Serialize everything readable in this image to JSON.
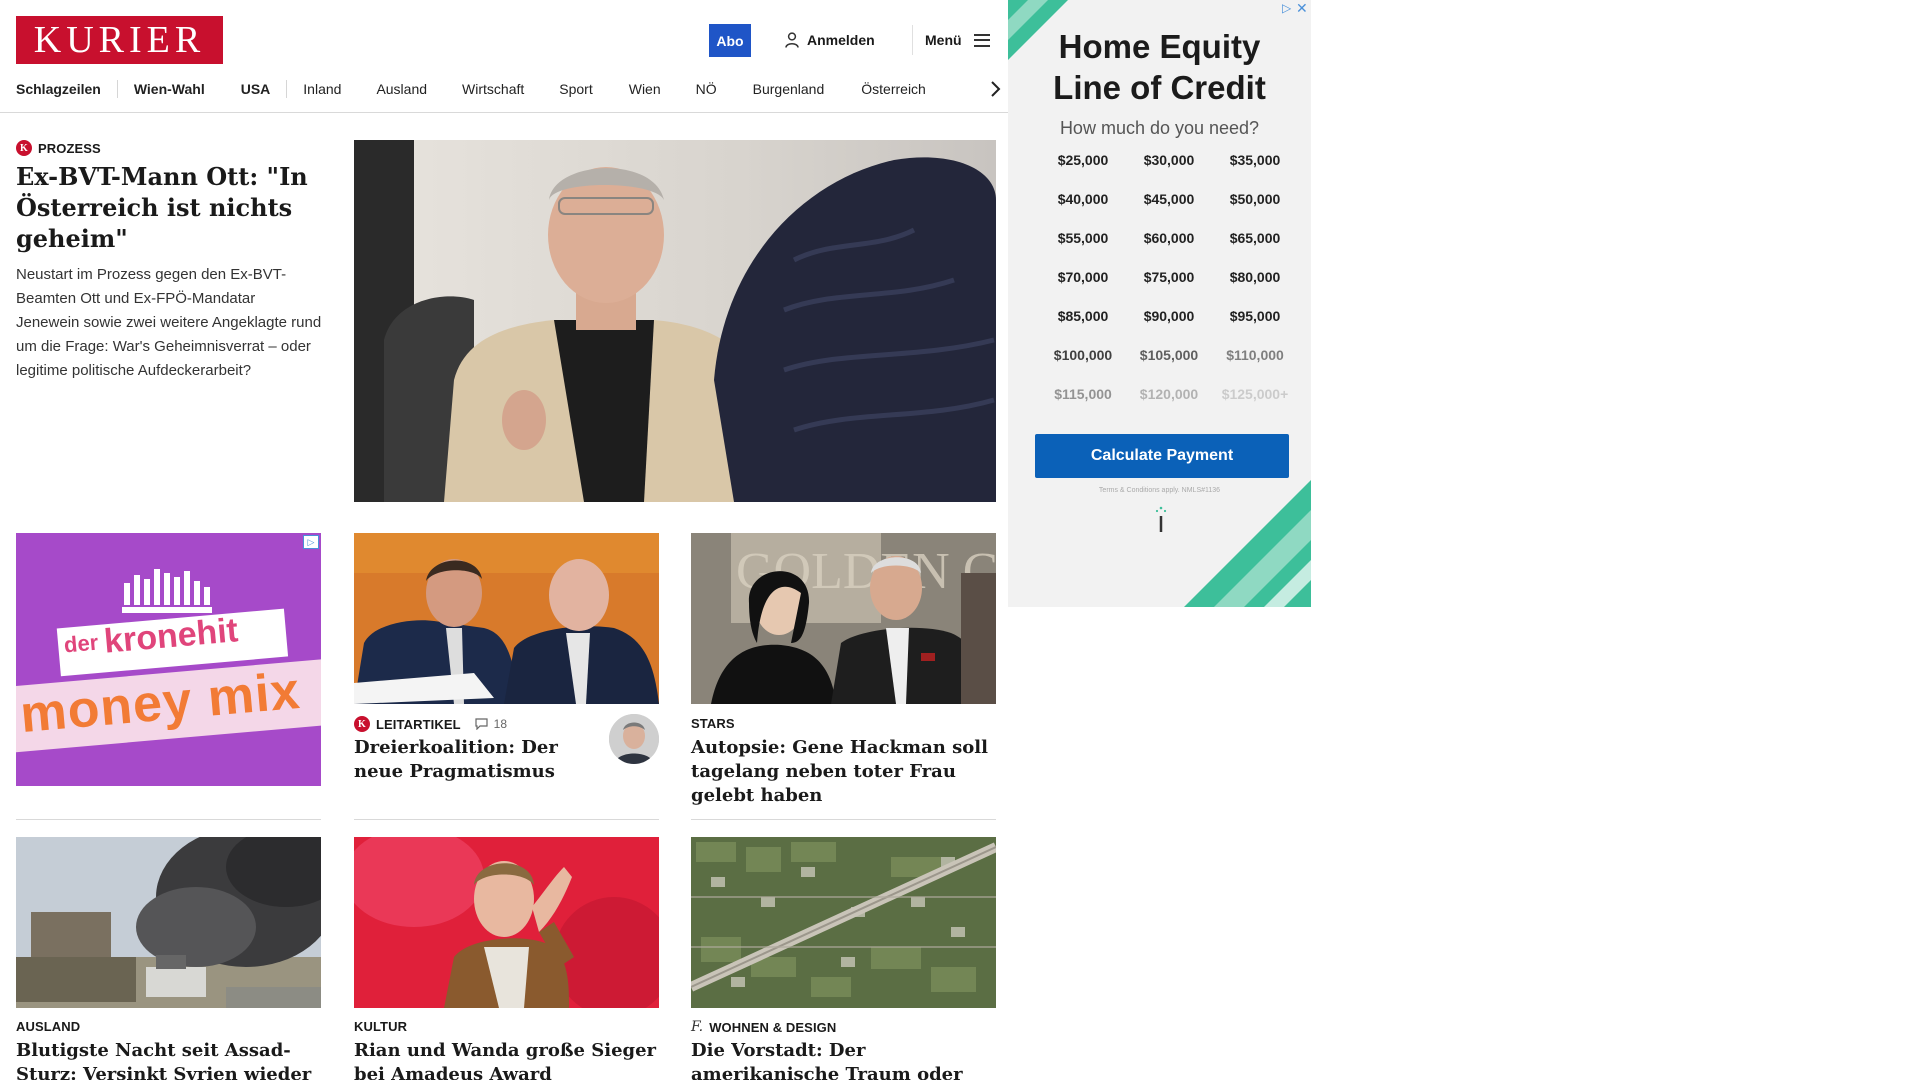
{
  "header": {
    "logo": "KURIER",
    "abo": "Abo",
    "login": "Anmelden",
    "menu": "Menü"
  },
  "nav": {
    "items": [
      "Schlagzeilen",
      "Wien-Wahl",
      "USA",
      "Inland",
      "Ausland",
      "Wirtschaft",
      "Sport",
      "Wien",
      "NÖ",
      "Burgenland",
      "Österreich"
    ]
  },
  "lead": {
    "kicker": "PROZESS",
    "badge": "K",
    "headline": "Ex-BVT-Mann Ott: \"In Österreich ist nichts geheim\"",
    "teaser": "Neustart im Prozess gegen den Ex-BVT-Beamten Ott und Ex-FPÖ-Mandatar Jenewein sowie zwei weitere Angeklagte rund um die Frage: War's Geheimnisverrat – oder legitime politische Aufdeckerarbeit?"
  },
  "promo": {
    "brand_small": "der",
    "brand": "kronehit",
    "title": "money mix"
  },
  "articles": [
    {
      "kicker": "LEITARTIKEL",
      "badge": "K",
      "comments": "18",
      "headline": "Dreierkoalition: Der neue Pragmatismus"
    },
    {
      "kicker": "STARS",
      "headline": "Autopsie: Gene Hackman soll tagelang neben toter Frau gelebt haben",
      "photo_text": "GOLDEN GLOBE AWARDS"
    },
    {
      "kicker": "AUSLAND",
      "headline": "Blutigste Nacht seit Assad-Sturz: Versinkt Syrien wieder im Chaos?"
    },
    {
      "kicker": "KULTUR",
      "headline": "Rian und Wanda große Sieger bei Amadeus Award"
    },
    {
      "kicker": "WOHNEN & DESIGN",
      "badge": "f.",
      "headline": "Die Vorstadt: Der amerikanische Traum oder Alptraum?"
    }
  ],
  "ad": {
    "title_line1": "Home Equity",
    "title_line2": "Line of Credit",
    "question": "How much do you need?",
    "amounts": [
      "$25,000",
      "$30,000",
      "$35,000",
      "$40,000",
      "$45,000",
      "$50,000",
      "$55,000",
      "$60,000",
      "$65,000",
      "$70,000",
      "$75,000",
      "$80,000",
      "$85,000",
      "$90,000",
      "$95,000",
      "$100,000",
      "$105,000",
      "$110,000",
      "$115,000",
      "$120,000",
      "$125,000+"
    ],
    "button": "Calculate Payment",
    "terms": "Terms & Conditions apply. NMLS#1136"
  },
  "colors": {
    "brand_red": "#c8102e",
    "abo_blue": "#1f55c7",
    "ad_button": "#0b61b8",
    "promo_purple": "#a64ac9",
    "ad_stripe_green": "#3dbf9a"
  }
}
